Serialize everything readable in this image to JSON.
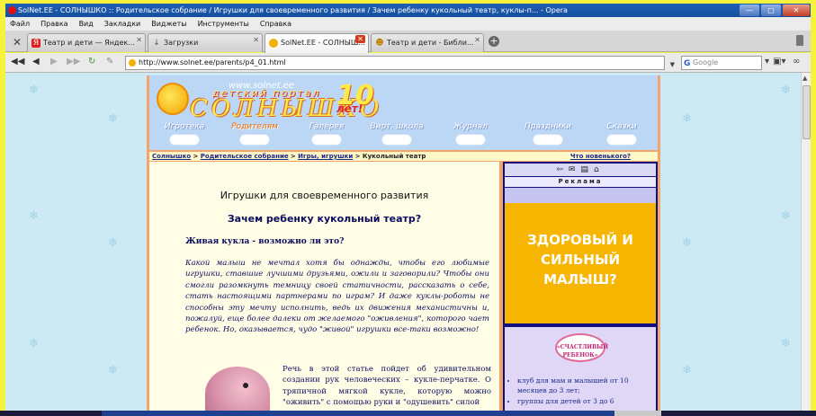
{
  "window": {
    "title": "SolNet.EE - СОЛНЫШКО :: Родительское собрание / Игрушки для своевременного развития / Зачем ребенку кукольный театр, куклы-п... - Opera",
    "controls": [
      "—",
      "▢",
      "✕"
    ]
  },
  "menu": [
    "Файл",
    "Правка",
    "Вид",
    "Закладки",
    "Виджеты",
    "Инструменты",
    "Справка"
  ],
  "tabs": [
    {
      "label": "Театр и дети — Яндек...",
      "icon": "yandex-icon"
    },
    {
      "label": "Загрузки",
      "icon": "download-icon"
    },
    {
      "label": "SolNet.EE - СОЛНЫШ...",
      "icon": "sun-icon",
      "active": true
    },
    {
      "label": "Театр и дети - Библи...",
      "icon": "masks-icon"
    }
  ],
  "address": {
    "url": "http://www.solnet.ee/parents/p4_01.html",
    "search_placeholder": "Google"
  },
  "site": {
    "logo_url": "www.solnet.ee",
    "logo_sub": "детский портал",
    "logo_name": "СОЛНЫШКО",
    "logo_years_num": "10",
    "logo_years": "лет!",
    "nav": [
      "Игротека",
      "Родителям",
      "Галерея",
      "Вирт. школа",
      "Журнал",
      "Праздники",
      "Сказки"
    ],
    "breadcrumbs": [
      "Солнышко",
      "Родительское собрание",
      "Игры, игрушки"
    ],
    "breadcrumb_current": "Кукольный театр",
    "news_link": "Что новенького?"
  },
  "article": {
    "heading": "Игрушки для своевременного развития",
    "subheading": "Зачем ребенку кукольный театр?",
    "section_title": "Живая кукла - возможно ли это?",
    "intro": "Какой малыш не мечтал хотя бы однажды, чтобы его любимые игрушки, ставшие лучшими друзьями, ожили и заговорили? Чтобы они смогли разомкнуть темницу своей статичности, рассказать о себе, стать настоящими партнерами по играм? И даже куклы-роботы не способны эту мечту исполнить, ведь их движения механистичны и, пожалуй, еще более далеки от желаемого \"оживления\", которого чает ребенок. Но, оказывается, чудо \"живой\" игрушки все-таки возможно!",
    "body": "Речь в этой статье пойдет об удивительном создании рук человеческих – кукле-перчатке. О тряпичной мягкой кукле, которую можно \"оживить\" с помощью руки и \"одушевить\" силой"
  },
  "sidebar": {
    "ad_label": "Реклама",
    "ad_text": "ЗДОРОВЫЙ И СИЛЬНЫЙ МАЛЫШ?",
    "badge": "«СЧАСТЛИВЫЙ РЕБЕНОК»",
    "promo_items": [
      "клуб для мам и малышей от 10 месяцев до 3 лет;",
      "группы для детей от 3 до 6"
    ]
  }
}
